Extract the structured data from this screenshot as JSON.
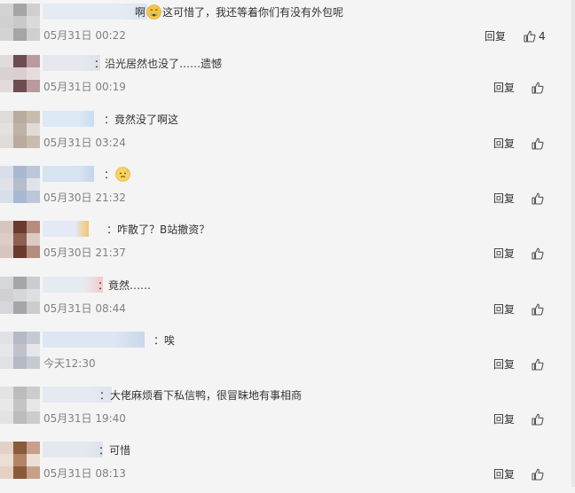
{
  "colors": {
    "background": "#f4f4f4",
    "timestamp": "#808080",
    "text": "#333333"
  },
  "icons": {
    "like": "thumbs-up-icon",
    "emoji_cry": "crying-face-emoji",
    "emoji_sweat": "sweat-face-emoji"
  },
  "comments": [
    {
      "pre": "啊",
      "emoji": "crying-face-emoji",
      "text": "这可惜了，我还等着你们有没有外包呢",
      "time": "05月31日 00:22",
      "reply": "回复",
      "likes": "4"
    },
    {
      "pre": "",
      "emoji": "",
      "text": "：沿光居然也没了……遗憾",
      "time": "05月31日 00:19",
      "reply": "回复",
      "likes": ""
    },
    {
      "pre": "",
      "emoji": "",
      "text": "：竟然没了啊这",
      "time": "05月31日 03:24",
      "reply": "回复",
      "likes": ""
    },
    {
      "pre": "：",
      "emoji": "sweat-face-emoji",
      "text": "",
      "time": "05月30日 21:32",
      "reply": "回复",
      "likes": ""
    },
    {
      "pre": "",
      "emoji": "",
      "text": "：咋散了？B站撤资？",
      "time": "05月30日 21:37",
      "reply": "回复",
      "likes": ""
    },
    {
      "pre": "",
      "emoji": "",
      "text": "：竟然……",
      "time": "05月31日 08:44",
      "reply": "回复",
      "likes": ""
    },
    {
      "pre": "",
      "emoji": "",
      "text": "：唉",
      "time": "今天12:30",
      "reply": "回复",
      "likes": ""
    },
    {
      "pre": "",
      "emoji": "",
      "text": "：大佬麻烦看下私信鸭，很冒昧地有事相商",
      "time": "05月31日 19:40",
      "reply": "回复",
      "likes": ""
    },
    {
      "pre": "",
      "emoji": "",
      "text": "：可惜",
      "time": "05月31日 08:13",
      "reply": "回复",
      "likes": ""
    }
  ]
}
